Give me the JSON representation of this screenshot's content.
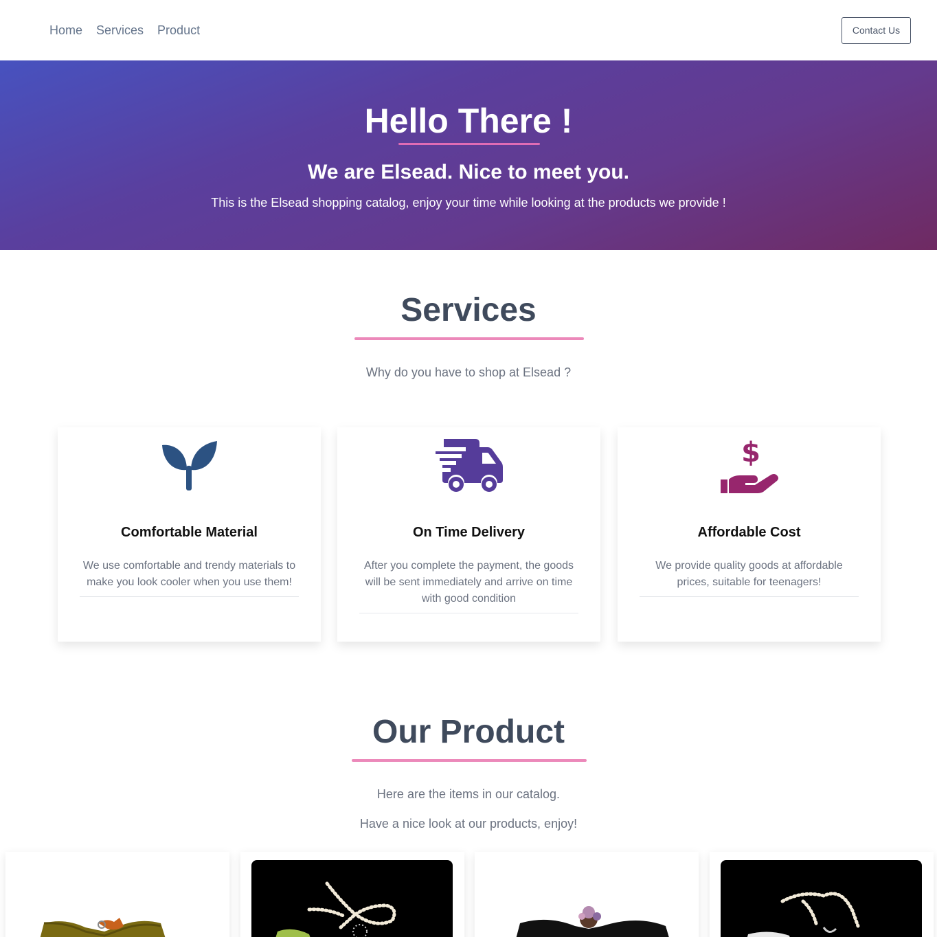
{
  "nav": {
    "links": [
      "Home",
      "Services",
      "Product"
    ],
    "contact_label": "Contact Us"
  },
  "hero": {
    "title": "Hello There !",
    "subtitle": "We are Elsead. Nice to meet you.",
    "description": "This is the Elsead shopping catalog, enjoy your time while looking at the products we provide !"
  },
  "services": {
    "title": "Services",
    "subtitle": "Why do you have to shop at Elsead ?",
    "cards": [
      {
        "icon": "seedling-icon",
        "color": "#2c5282",
        "title": "Comfortable Material",
        "text": "We use comfortable and trendy materials to make you look cooler when you use them!"
      },
      {
        "icon": "truck-fast-icon",
        "color": "#553c9a",
        "title": "On Time Delivery",
        "text": "After you complete the payment, the goods will be sent immediately and arrive on time with good condition"
      },
      {
        "icon": "hand-dollar-icon",
        "color": "#97266d",
        "title": "Affordable Cost",
        "text": "We provide quality goods at affordable prices, suitable for teenagers!"
      }
    ]
  },
  "product": {
    "title": "Our Product",
    "line1": "Here are the items in our catalog.",
    "line2": "Have a nice look at our products, enjoy!"
  },
  "colors": {
    "accent_pink": "#ec89ba",
    "hero_gradient": [
      "#4752bf",
      "#6f2a62"
    ]
  }
}
